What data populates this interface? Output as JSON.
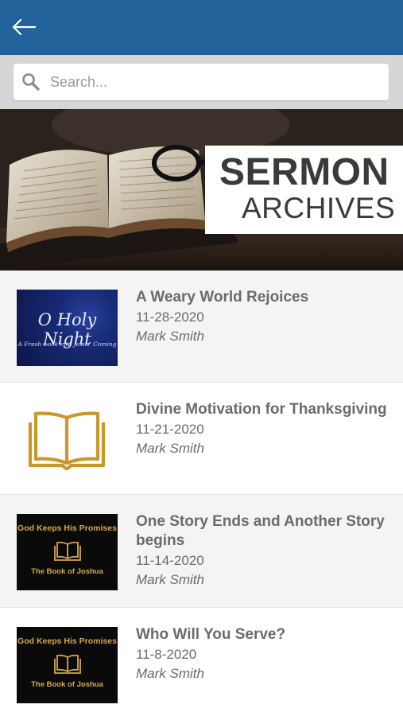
{
  "header": {
    "back_icon": "arrow-left-icon",
    "bar_color": "#22629b"
  },
  "search": {
    "placeholder": "Search...",
    "icon": "search-icon"
  },
  "banner": {
    "title": "SERMON",
    "subtitle": "ARCHIVES"
  },
  "sermons": [
    {
      "title": "A Weary World Rejoices",
      "date": "11-28-2020",
      "speaker": "Mark Smith",
      "thumb_line1": "O Holy Night",
      "thumb_line2": "A Fresh Look into Jesus' Coming"
    },
    {
      "title": "Divine Motivation for Thanksgiving",
      "date": "11-21-2020",
      "speaker": "Mark Smith",
      "thumb_icon": "open-book-icon"
    },
    {
      "title": "One Story Ends and Another Story begins",
      "date": "11-14-2020",
      "speaker": "Mark Smith",
      "thumb_line1": "God Keeps His Promises",
      "thumb_line2": "The Book of Joshua"
    },
    {
      "title": "Who Will You Serve?",
      "date": "11-8-2020",
      "speaker": "Mark Smith",
      "thumb_line1": "God Keeps His Promises",
      "thumb_line2": "The Book of Joshua"
    }
  ],
  "colors": {
    "accent_gold": "#c9982b",
    "text_gray": "#6b6b6b"
  }
}
